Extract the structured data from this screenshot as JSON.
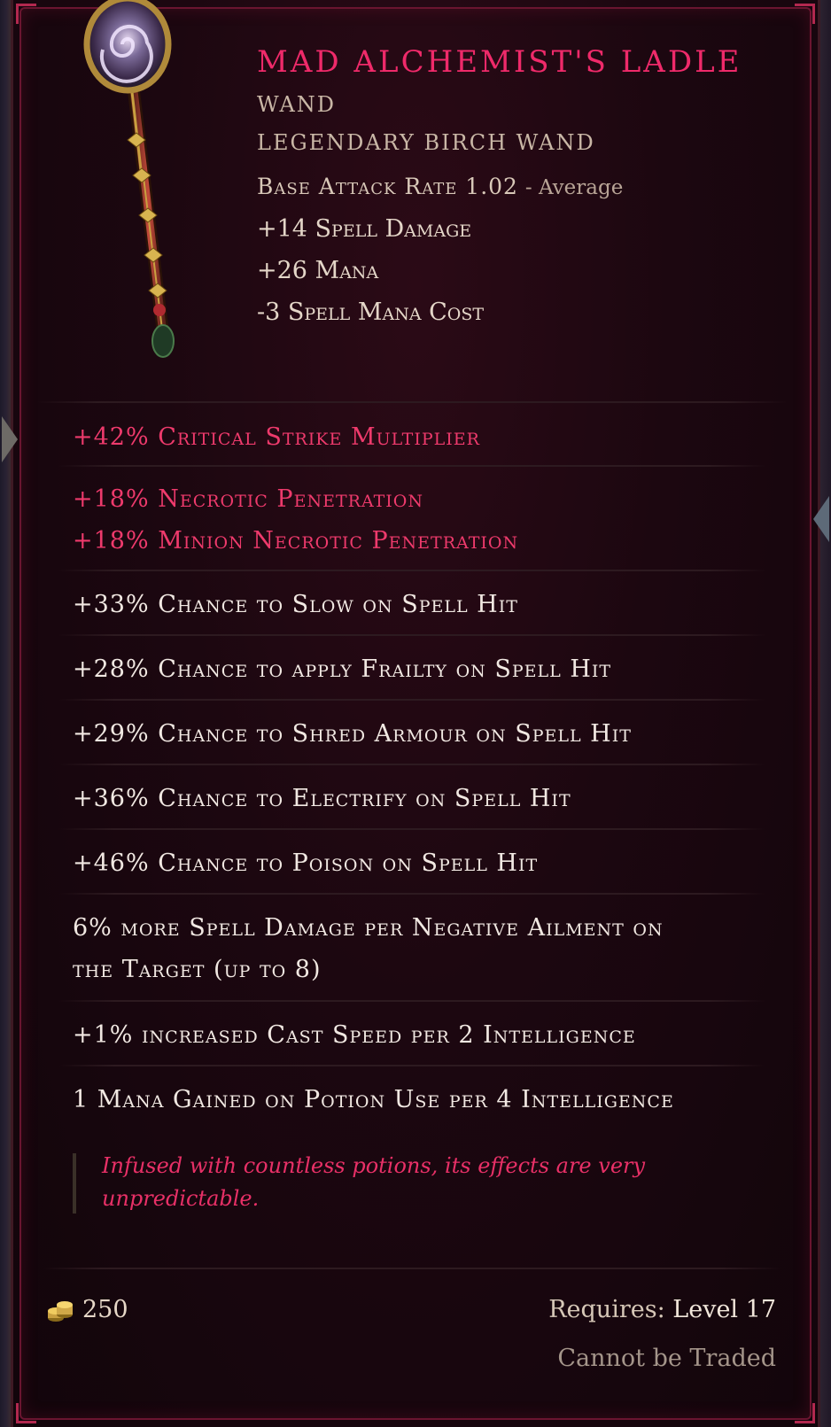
{
  "item": {
    "name": "Mad Alchemist's Ladle",
    "type": "Wand",
    "base": "Legendary Birch Wand",
    "attack_rate_label": "Base Attack Rate 1.02",
    "attack_rate_desc": "- Average",
    "implicits": [
      "+14 Spell Damage",
      "+26 Mana",
      "-3 Spell Mana Cost"
    ]
  },
  "mods": {
    "crit": "+42% Critical Strike Multiplier",
    "necrotic": "+18% Necrotic Penetration",
    "minion_necrotic": "+18% Minion Necrotic Penetration",
    "slow": "+33% Chance to Slow on Spell Hit",
    "frailty": "+28% Chance to apply Frailty on Spell Hit",
    "shred": "+29% Chance to Shred Armour on Spell Hit",
    "electrify": "+36% Chance to Electrify on Spell Hit",
    "poison": "+46% Chance to Poison on Spell Hit",
    "ailment_line1": "6% more Spell Damage per Negative Ailment on",
    "ailment_line2": "the Target (up to 8)",
    "cast_speed": "+1% increased Cast Speed per 2 Intelligence",
    "mana_gain": "1 Mana Gained on Potion Use per 4 Intelligence"
  },
  "lore": "Infused with countless potions, its effects are very unpredictable.",
  "footer": {
    "price": "250",
    "requires_label": "Requires:",
    "requires_level": "Level 17",
    "trade": "Cannot be Traded"
  },
  "colors": {
    "title": "#ef2a6a",
    "red_mod": "#ee3a6c",
    "white_mod": "#f1e8e2",
    "lore": "#e83067",
    "frame": "#6a1530"
  },
  "icons": [
    "wand-item-icon",
    "gold-coins-icon"
  ]
}
